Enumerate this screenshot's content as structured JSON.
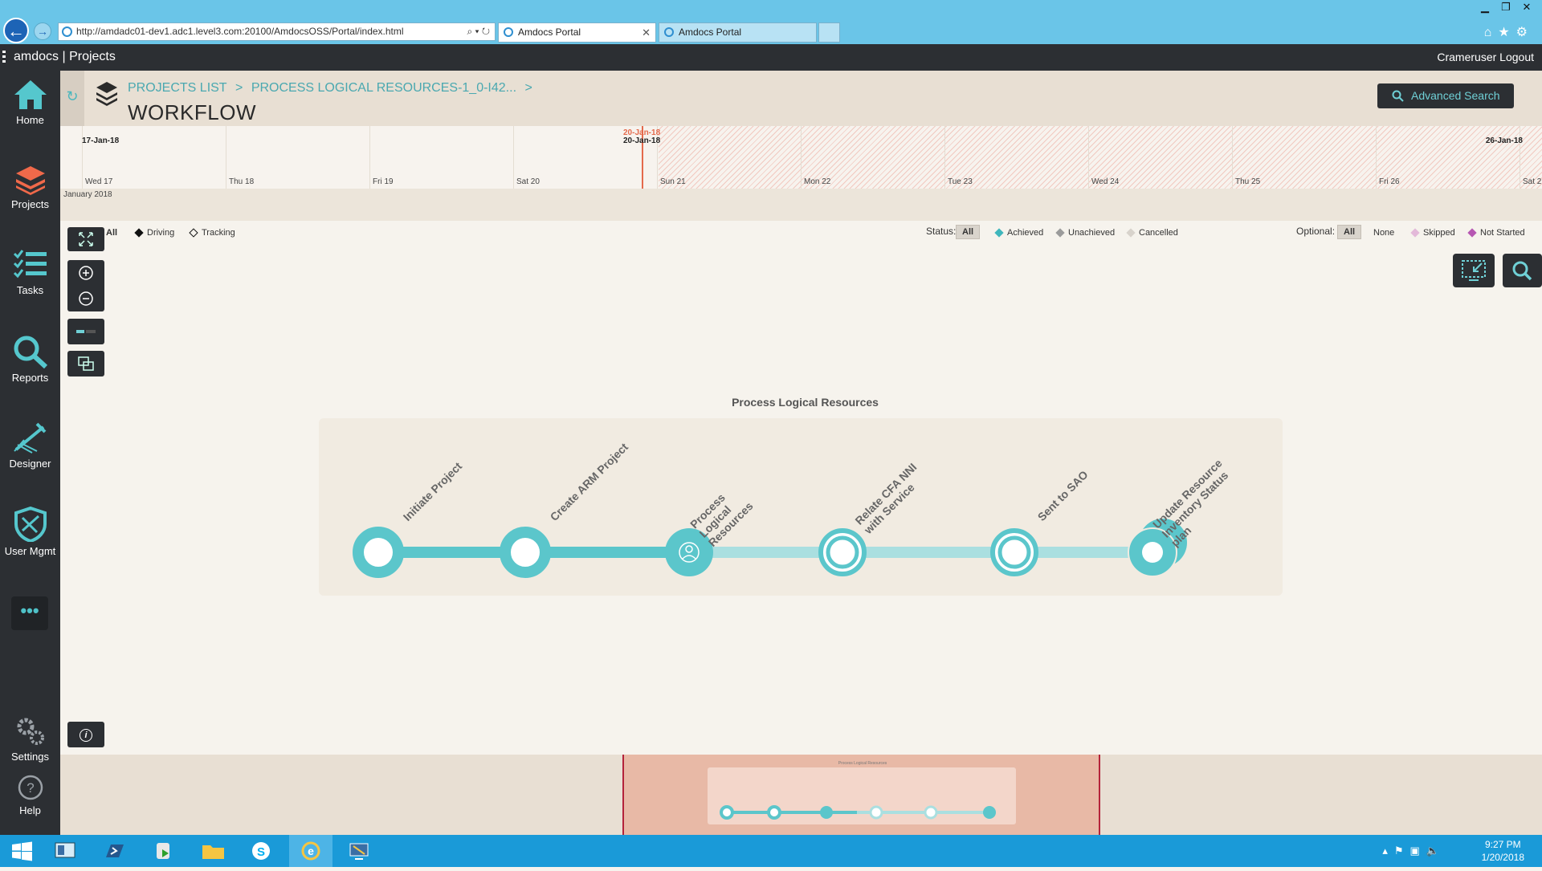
{
  "browser": {
    "url": "http://amdadc01-dev1.adc1.level3.com:20100/AmdocsOSS/Portal/index.html",
    "tabs": [
      {
        "label": "Amdocs Portal"
      },
      {
        "label": "Amdocs Portal"
      }
    ]
  },
  "app": {
    "title": "amdocs | Projects",
    "user_logout": "Crameruser Logout"
  },
  "sidebar": {
    "items": [
      {
        "label": "Home"
      },
      {
        "label": "Projects"
      },
      {
        "label": "Tasks"
      },
      {
        "label": "Reports"
      },
      {
        "label": "Designer"
      },
      {
        "label": "User Mgmt"
      },
      {
        "label": "Settings"
      },
      {
        "label": "Help"
      }
    ],
    "more": "•••"
  },
  "header": {
    "breadcrumb": [
      "PROJECTS LIST",
      ">",
      "PROCESS LOGICAL RESOURCES-1_0-I42...",
      ">"
    ],
    "title": "WORKFLOW",
    "advanced_search": "Advanced Search"
  },
  "timeline": {
    "start": "17-Jan-18",
    "today_red": "20-Jan-18",
    "today": "20-Jan-18",
    "end": "26-Jan-18",
    "days": [
      "Wed 17",
      "Thu 18",
      "Fri 19",
      "Sat 20",
      "Sun 21",
      "Mon 22",
      "Tue 23",
      "Wed 24",
      "Thu 25",
      "Fri 26",
      "Sat 2"
    ],
    "month": "January 2018"
  },
  "filters": {
    "type_all": "All",
    "driving": "Driving",
    "tracking": "Tracking",
    "status_label": "Status:",
    "status_all": "All",
    "achieved": "Achieved",
    "unachieved": "Unachieved",
    "cancelled": "Cancelled",
    "optional_label": "Optional:",
    "optional_all": "All",
    "none": "None",
    "skipped": "Skipped",
    "not_started": "Not Started"
  },
  "workflow": {
    "title": "Process Logical Resources",
    "steps": [
      {
        "label": "Initiate Project"
      },
      {
        "label": "Create ARM Project"
      },
      {
        "label": "Process Logical Resources"
      },
      {
        "label": "Relate CFA NNI with Service"
      },
      {
        "label": "Sent to SAO"
      },
      {
        "label": "Update Resource Inventory Status plan"
      }
    ]
  },
  "minimap": {
    "title": "Process Logical Resources"
  },
  "taskbar": {
    "time": "9:27 PM",
    "date": "1/20/2018"
  },
  "colors": {
    "accent": "#5bc6cb",
    "accent_light": "#aadfe0",
    "dark": "#2c2f33",
    "today": "#e46a4c"
  }
}
